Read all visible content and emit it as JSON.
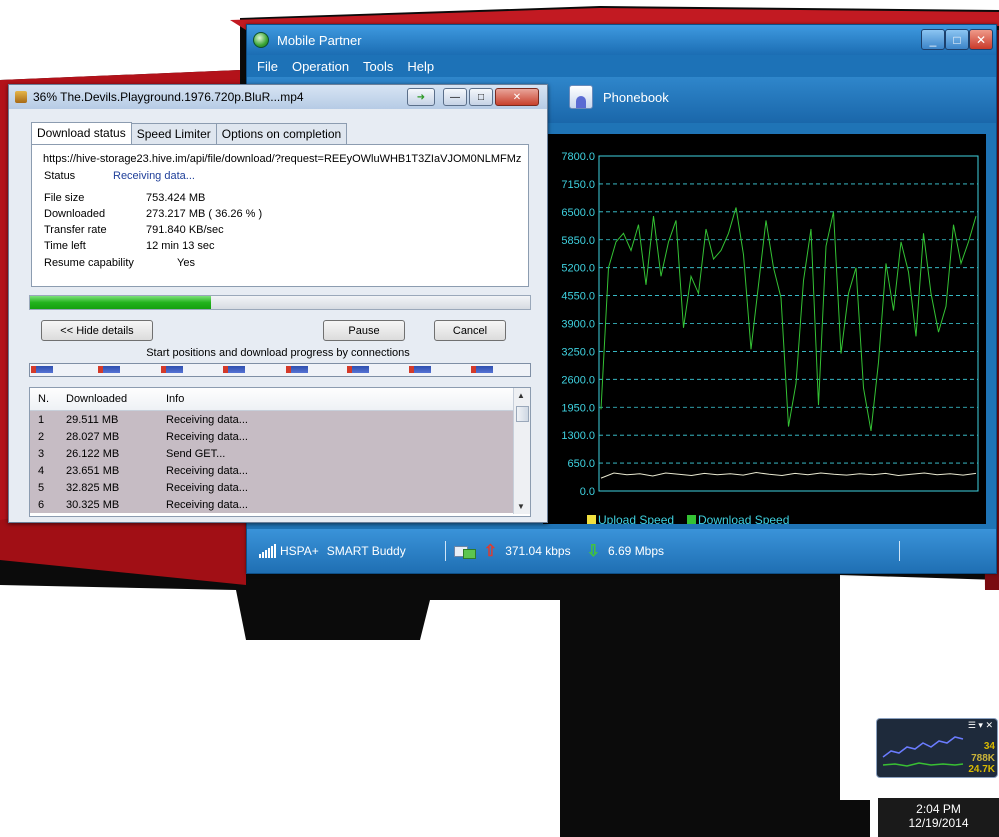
{
  "mobile_partner": {
    "title": "Mobile Partner",
    "menu": [
      "File",
      "Operation",
      "Tools",
      "Help"
    ],
    "toolbar_item": "Phonebook",
    "window_buttons": {
      "minimize": "_",
      "maximize": "□",
      "close": "✕"
    },
    "status": {
      "network": "HSPA+",
      "operator": "SMART Buddy",
      "upload_rate": "371.04 kbps",
      "download_rate": "6.69 Mbps"
    }
  },
  "chart_data": {
    "type": "line",
    "y_ticks": [
      "7800.0",
      "7150.0",
      "6500.0",
      "5850.0",
      "5200.0",
      "4550.0",
      "3900.0",
      "3250.0",
      "2600.0",
      "1950.0",
      "1300.0",
      "650.0",
      "0.0"
    ],
    "ylim": [
      0,
      7800
    ],
    "grid": true,
    "legend_position": "bottom-left",
    "series": [
      {
        "name": "Upload Speed",
        "color": "#f0e040",
        "values": [
          300,
          420,
          380,
          400,
          350,
          420,
          390,
          360,
          410,
          380,
          400,
          370,
          430,
          390,
          360,
          410,
          380,
          420,
          390,
          370,
          400,
          380,
          410,
          360,
          390,
          420,
          380,
          400,
          370,
          410
        ]
      },
      {
        "name": "Download Speed",
        "color": "#34c234",
        "values": [
          1900,
          5200,
          5800,
          6000,
          5600,
          6200,
          4800,
          6400,
          5000,
          5800,
          6300,
          3800,
          5000,
          4600,
          6100,
          5400,
          5600,
          6000,
          6600,
          5500,
          3300,
          4800,
          6300,
          5200,
          4500,
          1500,
          2500,
          4900,
          6100,
          2000,
          5700,
          6500,
          3200,
          4600,
          5200,
          2400,
          1400,
          3000,
          5300,
          4200,
          5800,
          5100,
          3600,
          6000,
          4600,
          3700,
          4300,
          6200,
          5300,
          5800,
          6400
        ]
      }
    ]
  },
  "download_dialog": {
    "title": "36% The.Devils.Playground.1976.720p.BluR...mp4",
    "tabs": [
      "Download status",
      "Speed Limiter",
      "Options on completion"
    ],
    "url": "https://hive-storage23.hive.im/api/file/download/?request=REEyOWluWHB1T3ZIaVJOM0NLMFMz",
    "status_label": "Status",
    "status_value": "Receiving data...",
    "fields": [
      {
        "label": "File size",
        "value": "753.424  MB"
      },
      {
        "label": "Downloaded",
        "value": "273.217  MB  ( 36.26 % )"
      },
      {
        "label": "Transfer rate",
        "value": "791.840  KB/sec"
      },
      {
        "label": "Time left",
        "value": "12 min 13 sec"
      },
      {
        "label": "Resume capability",
        "value": "Yes"
      }
    ],
    "progress_percent": 36.26,
    "buttons": {
      "hide_details": "<< Hide details",
      "pause": "Pause",
      "cancel": "Cancel"
    },
    "connections_caption": "Start positions and download progress by connections",
    "connections_header": [
      "N.",
      "Downloaded",
      "Info"
    ],
    "connections": [
      {
        "n": "1",
        "downloaded": "29.511  MB",
        "info": "Receiving data..."
      },
      {
        "n": "2",
        "downloaded": "28.027  MB",
        "info": "Receiving data..."
      },
      {
        "n": "3",
        "downloaded": "26.122  MB",
        "info": "Send GET..."
      },
      {
        "n": "4",
        "downloaded": "23.651  MB",
        "info": "Receiving data..."
      },
      {
        "n": "5",
        "downloaded": "32.825  MB",
        "info": "Receiving data..."
      },
      {
        "n": "6",
        "downloaded": "30.325  MB",
        "info": "Receiving data..."
      }
    ]
  },
  "gadget": {
    "values": [
      "34",
      "788K",
      "24.7K"
    ]
  },
  "clock": {
    "time": "2:04 PM",
    "date": "12/19/2014"
  }
}
